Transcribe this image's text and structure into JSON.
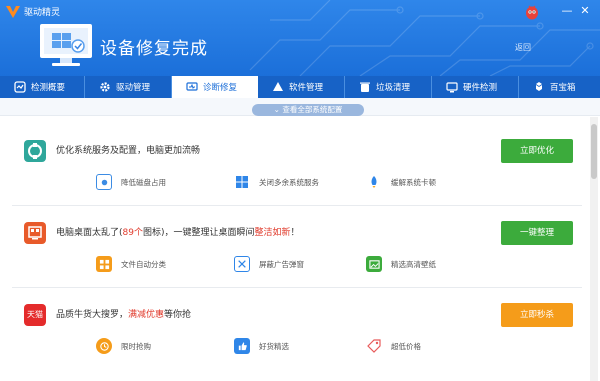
{
  "app": {
    "title": "驱动精灵"
  },
  "window": {
    "minimize_icon": "minimize-icon",
    "close_icon": "close-icon"
  },
  "hero": {
    "title": "设备修复完成",
    "back": "返回"
  },
  "tabs": [
    {
      "label": "检测概要",
      "icon": "overview-icon",
      "active": false
    },
    {
      "label": "驱动管理",
      "icon": "gear-icon",
      "active": false
    },
    {
      "label": "诊断修复",
      "icon": "diagnose-icon",
      "active": true
    },
    {
      "label": "软件管理",
      "icon": "software-icon",
      "active": false
    },
    {
      "label": "垃圾清理",
      "icon": "trash-icon",
      "active": false
    },
    {
      "label": "硬件检测",
      "icon": "hardware-icon",
      "active": false
    },
    {
      "label": "百宝箱",
      "icon": "toolbox-icon",
      "active": false
    }
  ],
  "expand": {
    "label": "查看全部系统配置"
  },
  "panels": [
    {
      "title_pre": "优化系统服务及配置，电脑更加流畅",
      "title_hl": "",
      "title_mid": "",
      "title_hl2": "",
      "title_post": "",
      "cta": "立即优化",
      "cta_color": "#3cab3c",
      "icon_color": "#2fa79b",
      "features": [
        "降低磁盘占用",
        "关闭多余系统服务",
        "缓解系统卡顿"
      ]
    },
    {
      "title_pre": "电脑桌面太乱了(",
      "title_hl": "89个",
      "title_mid": "图标)，一键整理让桌面瞬间",
      "title_hl2": "整洁如新",
      "title_post": "！",
      "cta": "一键整理",
      "cta_color": "#3cab3c",
      "icon_color": "#e85a2a",
      "features": [
        "文件自动分类",
        "屏蔽广告弹窗",
        "精选高清壁纸"
      ]
    },
    {
      "title_pre": "品质牛货大搜罗，",
      "title_hl": "满减优惠",
      "title_mid": "等你抢",
      "title_hl2": "",
      "title_post": "",
      "cta": "立即秒杀",
      "cta_color": "#f59c1a",
      "icon_color": "#e42b2b",
      "badge": "天猫",
      "features": [
        "限时抢购",
        "好货精选",
        "超低价格"
      ]
    }
  ],
  "colors": {
    "header": "#1f73dd",
    "tabbar": "#1762c6",
    "accent": "#1b6ed8"
  }
}
